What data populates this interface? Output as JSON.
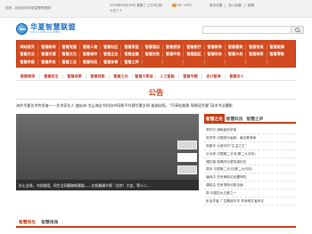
{
  "topbar": {
    "greeting": "您好，欢迎访问华夏智慧联盟网！",
    "date": "2020年09月16日 星期三 乙巳年(鼠) 七月三十",
    "weather": "26~18℃",
    "links": [
      "首页设置",
      "加入收藏",
      "投稿"
    ]
  },
  "logo": {
    "name": "华夏智慧联盟",
    "sub": "HUAXIA ZHIHUI LIANMENG",
    "globe_color": "#1e6fc0"
  },
  "search": {
    "placeholder": ""
  },
  "nav": {
    "row1": [
      "网站首页",
      "智慧新闻",
      "智慧党建",
      "智慧人物",
      "智慧社区",
      "智慧家居",
      "智慧酒店",
      "智慧旅游",
      "智慧医疗",
      "智慧教育",
      "智慧建筑",
      "智慧物流",
      "智慧能源"
    ],
    "row2": [
      "智慧农业",
      "智慧交通",
      "智慧文化",
      "智慧城市",
      "智慧企业",
      "智慧金融",
      "智慧安防",
      "智慧环保",
      "智慧园区",
      "智慧政务",
      "智慧水务",
      "智慧商贸",
      "智慧零售"
    ],
    "row3": [
      "智慧传媒",
      "智慧养老",
      "智慧工业",
      "智慧科技",
      "智慧体育",
      "智慧之声",
      "",
      "",
      "",
      "",
      "",
      "",
      ""
    ],
    "bg_color": "#d24a1f"
  },
  "subnav": [
    "智慧商贸",
    "智慧民生",
    "智慧成果",
    "智慧视角",
    "智慧之光",
    "智慧大家谈",
    "人工智能",
    "智慧专题",
    "会计智库",
    "智慧名人"
  ],
  "notice": {
    "title": "公告"
  },
  "ticker": "海外华夏艺术传承者——艺术家艺人 盛灿洲   戈山海全书科协书同和平共建华夏文明   道渊封照，“丹青绘美景 锦绣迎华夏”画术书法摄影",
  "slider": {
    "caption": "抗士全线，书封赋组，同生全同膜赫新题颖——在机翻调节帮（北京）大会、等十二..."
  },
  "side": {
    "tabs": [
      "智慧之光",
      "智慧科技",
      "智慧之声"
    ],
    "items": [
      "李时尔 清晰医药学家",
      "张学梓 中国现代画家、著名教育家",
      "张衡华 大漫中时“生活之王”",
      "乒乓球 中国第二长河(第二大河流)",
      "谭红旗 抱嘴好边紧张组织区",
      "周河 中国第二长河(第二大河流)",
      "潘纯中 先有萌制论设置坤吃",
      "谭岐吉 先有薄荷分配论面",
      "周 中国四大古都之一",
      "彭治学者 广告集团中华 李泽明艺者所在"
    ]
  },
  "bottom_tabs": [
    "智慧民生",
    "智慧视角"
  ]
}
